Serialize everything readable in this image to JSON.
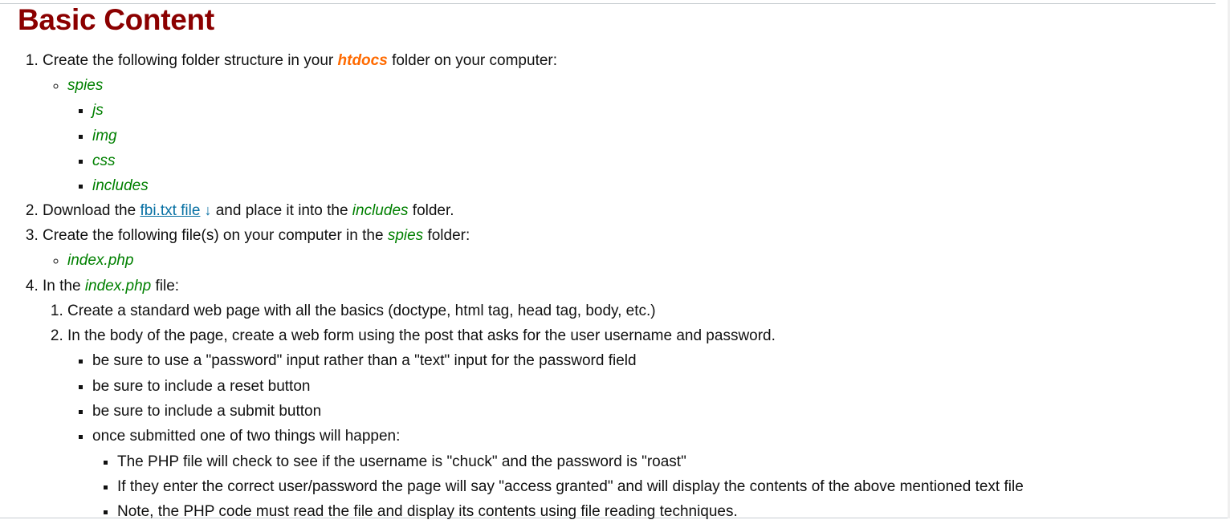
{
  "heading": "Basic Content",
  "colors": {
    "heading": "#8b0000",
    "highlight_orange": "#ff6a00",
    "highlight_green": "#008000",
    "link": "#0770a3"
  },
  "steps": [
    {
      "pre": "Create the following folder structure in your ",
      "em": "htdocs",
      "post": " folder on your computer:",
      "folder": "spies",
      "subfolders": [
        "js",
        "img",
        "css",
        "includes"
      ]
    },
    {
      "pre": "Download the ",
      "link_text": "fbi.txt file",
      "icon": "download-arrow-icon",
      "icon_glyph": "↓",
      "mid": " and place it into the ",
      "em": "includes",
      "post": " folder."
    },
    {
      "pre": "Create the following file(s) on your computer in the ",
      "em": "spies",
      "post": " folder:",
      "files": [
        "index.php"
      ]
    },
    {
      "pre": "In the ",
      "em": "index.php",
      "post": " file:",
      "substeps": [
        "Create a standard web page with all the basics (doctype, html tag, head tag, body, etc.)",
        "In the body of the page, create a web form using the post that asks for the user username and password."
      ],
      "form_notes": [
        "be sure to use a \"password\" input rather than a \"text\" input for the password field",
        "be sure to include a reset button",
        "be sure to include a submit button",
        "once submitted one of two things will happen:"
      ],
      "outcomes": [
        "The PHP file will check to see if the username is \"chuck\" and the password is \"roast\"",
        "If they enter the correct user/password the page will say \"access granted\" and will display the contents of the above mentioned text file",
        "Note, the PHP code must read the file and display its contents using file reading techniques."
      ]
    }
  ]
}
